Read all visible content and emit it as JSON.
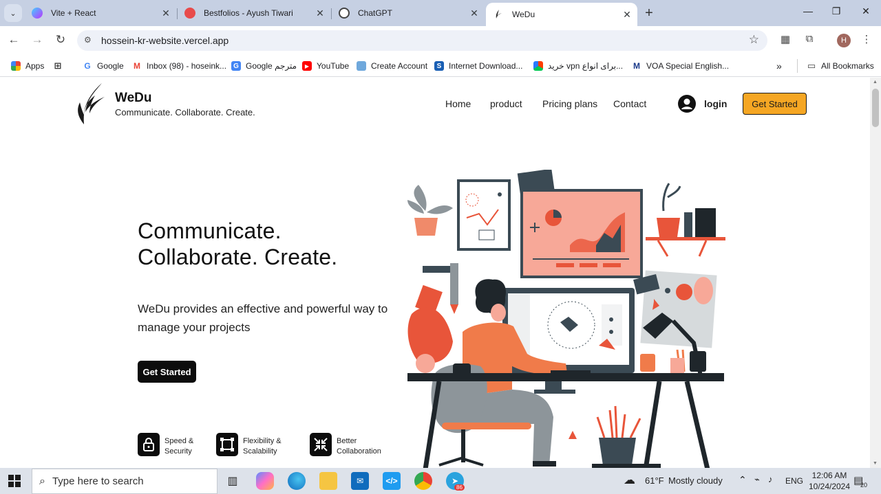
{
  "browser": {
    "tabs": [
      {
        "title": "Vite + React",
        "icon": "vite-icon",
        "color": "#9a6bff"
      },
      {
        "title": "Bestfolios - Ayush Tiwari",
        "icon": "bestfolios-icon",
        "color": "#e84b4b"
      },
      {
        "title": "ChatGPT",
        "icon": "chatgpt-icon",
        "color": "#444444"
      },
      {
        "title": "WeDu",
        "icon": "wedu-icon",
        "color": "#222222",
        "active": true
      }
    ],
    "url": "hossein-kr-website.vercel.app",
    "profile_initial": "H",
    "bookmarks": [
      {
        "label": "Apps",
        "icon": "apps-grid-icon"
      },
      {
        "label": "",
        "icon": "grid-icon"
      },
      {
        "label": "Google",
        "icon": "google-icon"
      },
      {
        "label": "Inbox (98) - hoseink...",
        "icon": "gmail-icon"
      },
      {
        "label": "Google مترجم",
        "icon": "translate-icon"
      },
      {
        "label": "YouTube",
        "icon": "youtube-icon"
      },
      {
        "label": "Create Account",
        "icon": "create-account-icon"
      },
      {
        "label": "Internet Download...",
        "icon": "idm-icon"
      },
      {
        "label": "خرید vpn برای انواع...",
        "icon": "vpn-icon"
      },
      {
        "label": "VOA Special English...",
        "icon": "voa-icon"
      }
    ],
    "all_bookmarks_label": "All Bookmarks"
  },
  "site": {
    "brand_name": "WeDu",
    "brand_tagline": "Communicate. Collaborate. Create.",
    "nav": [
      "Home",
      "product",
      "Pricing plans",
      "Contact"
    ],
    "login_label": "login",
    "nav_cta": "Get Started",
    "hero": {
      "title_line1": "Communicate.",
      "title_line2": "Collaborate. Create.",
      "description": "WeDu provides an effective and powerful way to manage your projects",
      "cta": "Get Started"
    },
    "features": [
      {
        "label": "Speed & Security",
        "icon": "lock-icon"
      },
      {
        "label": "Flexibility & Scalability",
        "icon": "scale-frame-icon"
      },
      {
        "label": "Better Collaboration",
        "icon": "collaboration-arrows-icon"
      }
    ],
    "accent_color": "#f5a623"
  },
  "taskbar": {
    "search_placeholder": "Type here to search",
    "weather_temp": "61°F",
    "weather_text": "Mostly cloudy",
    "language": "ENG",
    "time": "12:06 AM",
    "date": "10/24/2024",
    "notification_count": "20",
    "telegram_badge": "86"
  }
}
